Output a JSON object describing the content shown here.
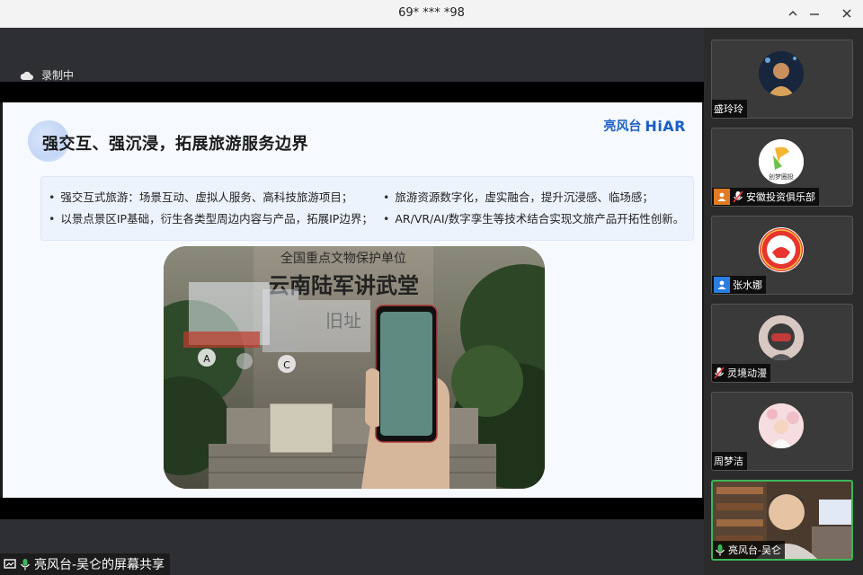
{
  "window": {
    "title": "69* *** *98"
  },
  "recording": {
    "label": "录制中"
  },
  "slide": {
    "title": "强交互、强沉浸，拓展旅游服务边界",
    "brand_cn": "亮风台",
    "brand_en": "HiAR",
    "bullets": [
      "强交互式旅游：场景互动、虚拟人服务、高科技旅游项目；",
      "旅游资源数字化，虚实融合，提升沉浸感、临场感；",
      "以景点景区IP基础，衍生各类型周边内容与产品，拓展IP边界；",
      "AR/VR/AI/数字孪生等技术结合实现文旅产品开拓性创新。"
    ],
    "photo_sign_lines": [
      "全国重点文物保护单位",
      "云南陆军讲武堂",
      "旧址"
    ]
  },
  "share": {
    "label": "亮风台-吴仑的屏幕共享"
  },
  "participants": [
    {
      "name": "盛玲玲",
      "icons": []
    },
    {
      "name": "安徽投资俱乐部",
      "icons": [
        "user-icon",
        "mic-muted-icon"
      ],
      "avatar_text": "创梦圈投"
    },
    {
      "name": "张水娜",
      "icons": [
        "user-icon"
      ]
    },
    {
      "name": "灵境动漫",
      "icons": [
        "mic-muted-icon"
      ]
    },
    {
      "name": "周梦洁",
      "icons": []
    },
    {
      "name": "亮风台-吴仑",
      "icons": [
        "mic-icon"
      ]
    }
  ],
  "colors": {
    "active_speaker": "#3bb75b",
    "brand": "#1a5fc4"
  }
}
